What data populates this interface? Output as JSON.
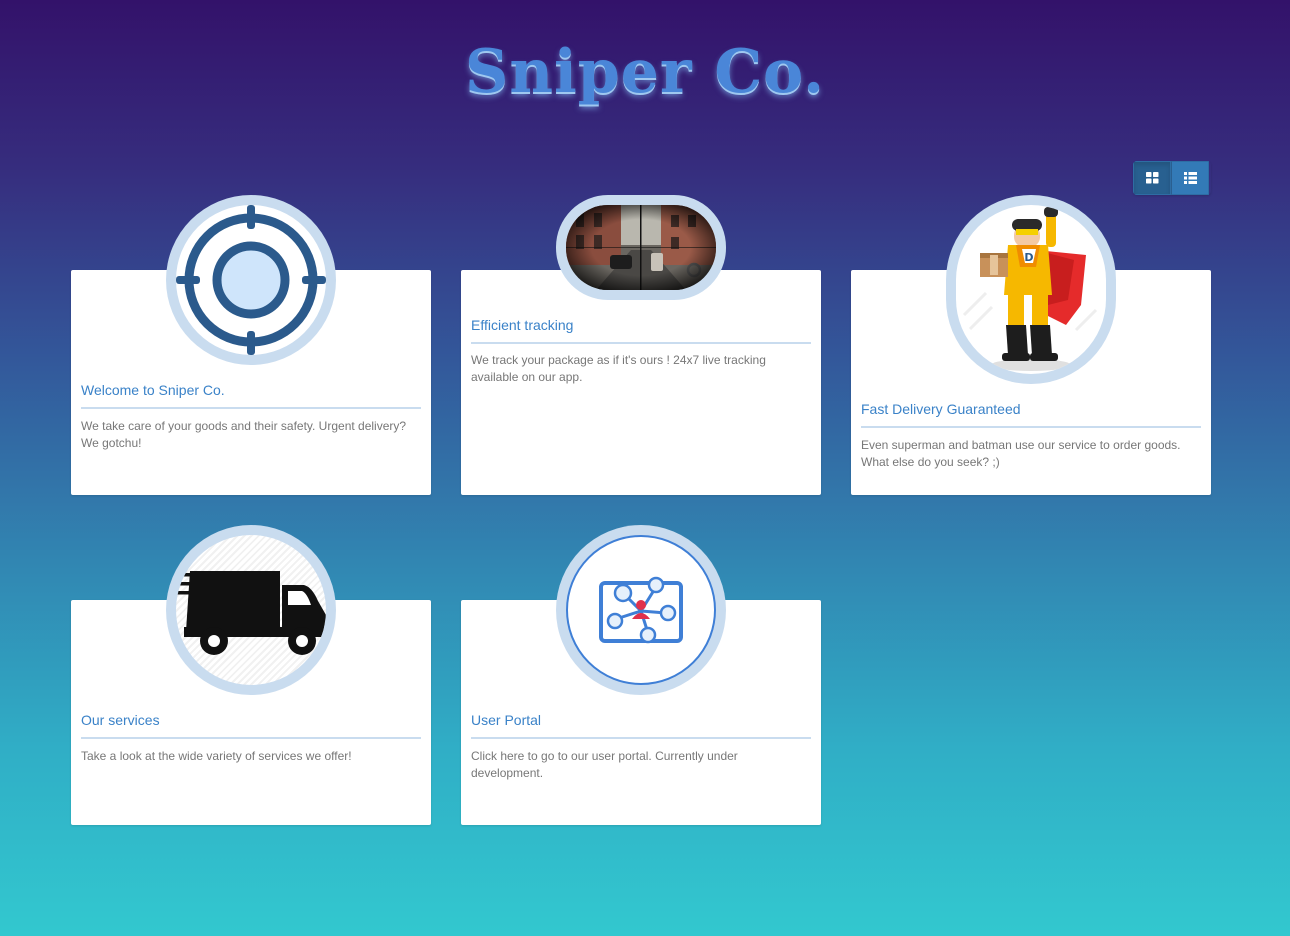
{
  "site": {
    "title": "Sniper Co."
  },
  "toolbar": {
    "grid_view_icon": "th-large-icon",
    "list_view_icon": "th-list-icon"
  },
  "colors": {
    "accent": "#337ab7",
    "card_title": "#3a82c8",
    "card_text": "#777777",
    "circle_frame": "#c9dcef"
  },
  "cards": [
    {
      "title": "Welcome to Sniper Co.",
      "text": "We take care of your goods and their safety. Urgent delivery? We gotchu!",
      "icon": "crosshair-icon"
    },
    {
      "title": "Efficient tracking",
      "text": "We track your package as if it's ours ! 24x7 live tracking available on our app.",
      "icon": "scope-view-image"
    },
    {
      "title": "Fast Delivery Guaranteed",
      "text": "Even superman and batman use our service to order goods. What else do you seek? ;)",
      "icon": "superhero-courier-image"
    },
    {
      "title": "Our services",
      "text": "Take a look at the wide variety of services we offer!",
      "icon": "delivery-truck-icon"
    },
    {
      "title": "User Portal",
      "text": "Click here to go to our user portal. Currently under development.",
      "icon": "user-network-icon"
    }
  ]
}
